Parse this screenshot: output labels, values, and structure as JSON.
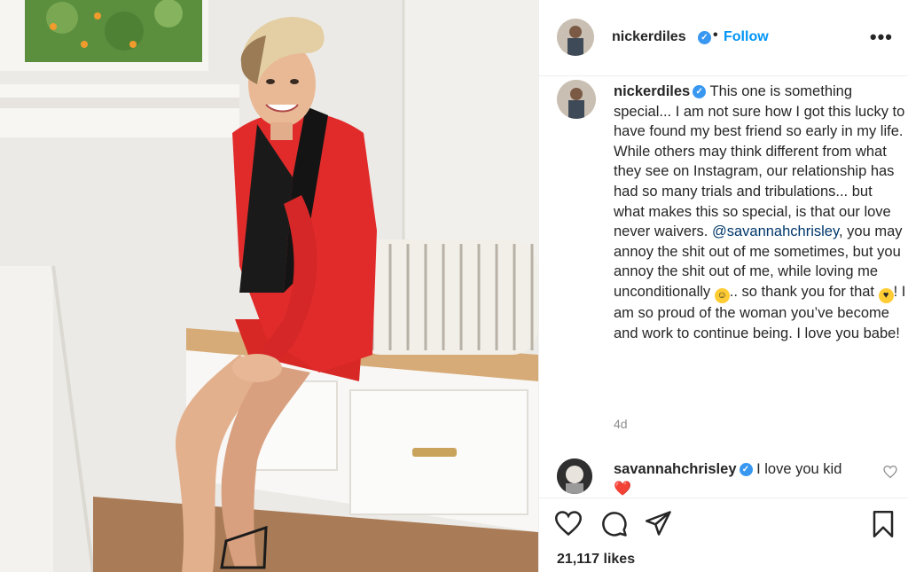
{
  "post": {
    "image_alt": "Woman in red blazer sitting on a window bench",
    "header": {
      "username": "nickerdiles",
      "separator": "•",
      "follow_label": "Follow",
      "more_label": "•••"
    },
    "caption": {
      "username": "nickerdiles",
      "text_1": "This one is something special... I am not sure how I got this lucky to have found my best friend so early in my life. While others may think different from what they see on Instagram, our relationship has had so many trials and tribulations... but what makes this so special, is that our love never waivers. ",
      "mention": "@savannahchrisley",
      "text_2": ", you may annoy the shit out of me sometimes, but you annoy the shit out of me, while loving me unconditionally ",
      "text_3": ".. so thank you for that ",
      "text_4": "! I am so proud of the woman you’ve become and work to continue being. I love you babe!",
      "emoji_1": "grinning-face",
      "emoji_2": "face-blowing-kiss"
    },
    "timestamp": "4d",
    "comment": {
      "username": "savannahchrisley",
      "text": "I love you kid",
      "emoji": "❤️"
    },
    "likes": "21,117 likes"
  },
  "icons": [
    "verified-icon",
    "heart-icon",
    "comment-icon",
    "share-icon",
    "bookmark-icon"
  ],
  "colors": {
    "accent": "#0095f6",
    "verified": "#3897f0",
    "text": "#262626",
    "muted": "#8e8e8e",
    "heart": "#e0245e"
  }
}
